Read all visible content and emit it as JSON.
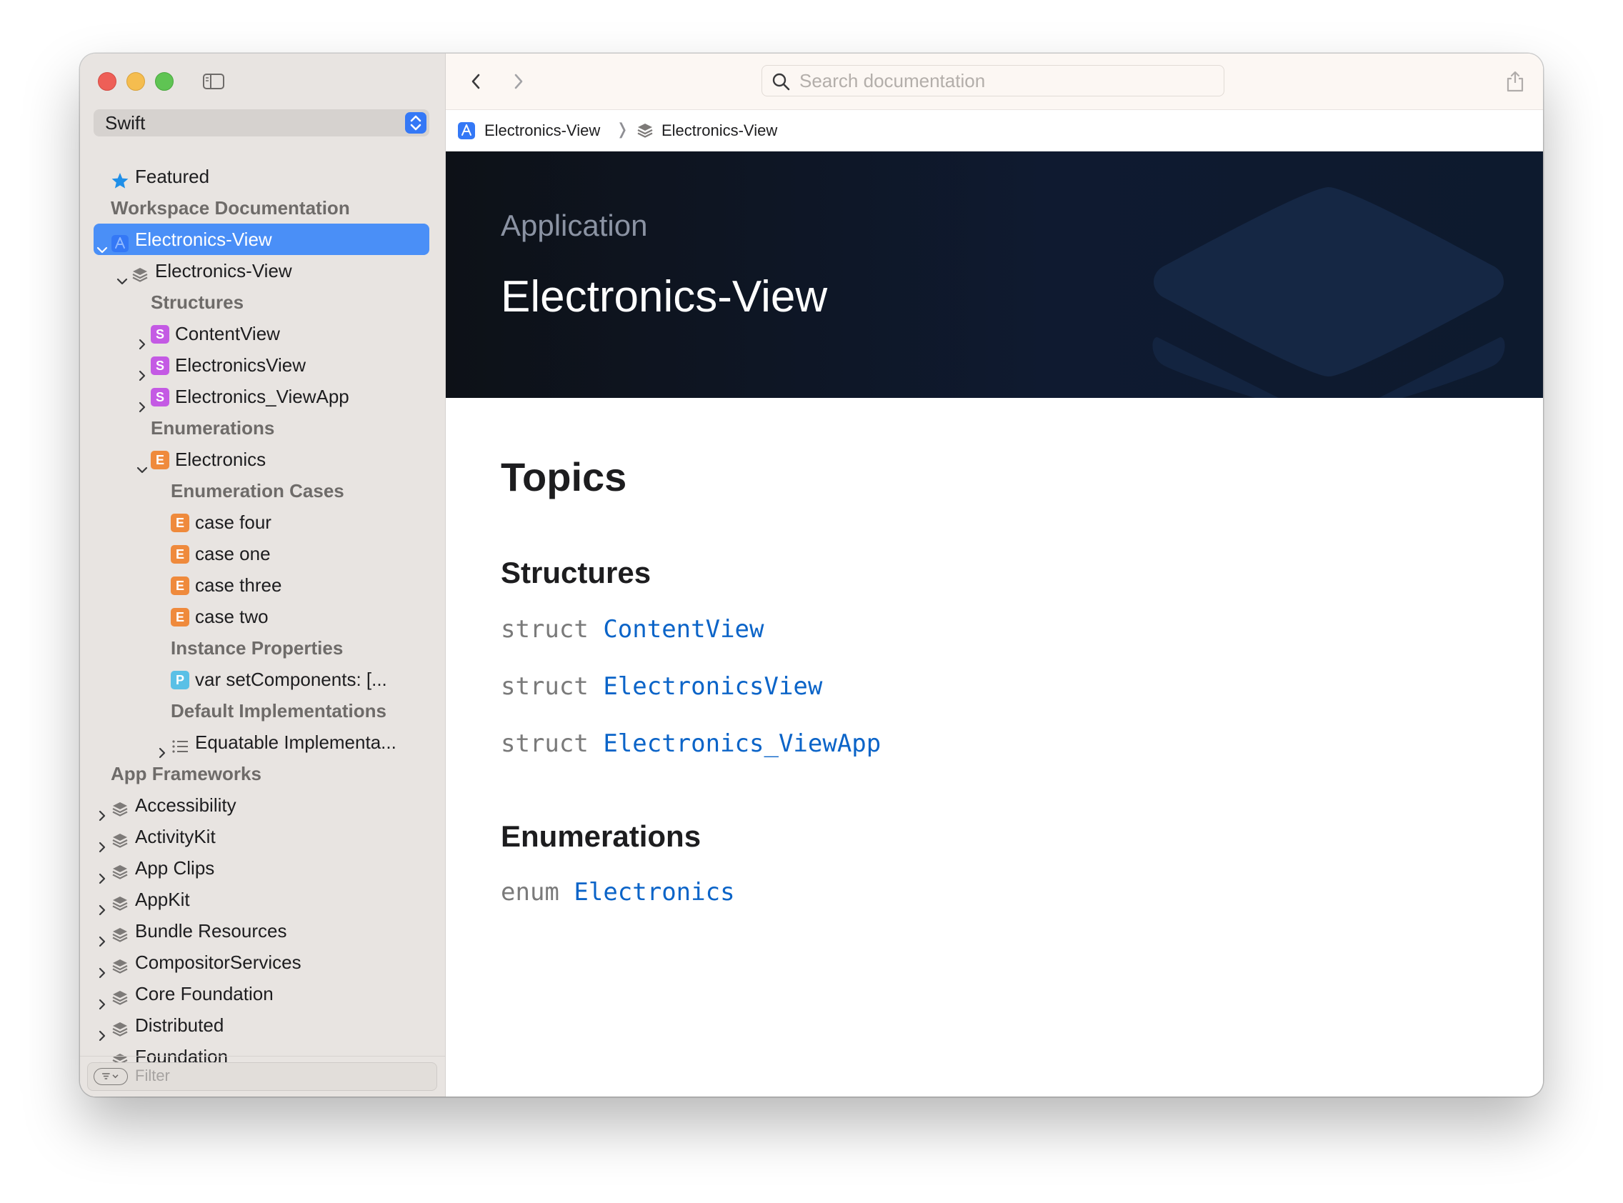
{
  "sidebar": {
    "language": "Swift",
    "filter_placeholder": "Filter",
    "tree": [
      {
        "label": "Featured",
        "level": 1,
        "kind": "featured",
        "expanded": null
      },
      {
        "label": "Workspace Documentation",
        "level": 1,
        "kind": "header"
      },
      {
        "label": "Electronics-View",
        "level": 1,
        "kind": "app",
        "expanded": true,
        "selected": true
      },
      {
        "label": "Electronics-View",
        "level": 2,
        "kind": "module",
        "expanded": true
      },
      {
        "label": "Structures",
        "level": 3,
        "kind": "header"
      },
      {
        "label": "ContentView",
        "level": 3,
        "kind": "struct",
        "expanded": false
      },
      {
        "label": "ElectronicsView",
        "level": 3,
        "kind": "struct",
        "expanded": false
      },
      {
        "label": "Electronics_ViewApp",
        "level": 3,
        "kind": "struct",
        "expanded": false
      },
      {
        "label": "Enumerations",
        "level": 3,
        "kind": "header"
      },
      {
        "label": "Electronics",
        "level": 3,
        "kind": "enum",
        "expanded": true
      },
      {
        "label": "Enumeration Cases",
        "level": 4,
        "kind": "header"
      },
      {
        "label": "case four",
        "level": 4,
        "kind": "enum"
      },
      {
        "label": "case one",
        "level": 4,
        "kind": "enum"
      },
      {
        "label": "case three",
        "level": 4,
        "kind": "enum"
      },
      {
        "label": "case two",
        "level": 4,
        "kind": "enum"
      },
      {
        "label": "Instance Properties",
        "level": 4,
        "kind": "header"
      },
      {
        "label": "var setComponents: [...",
        "level": 4,
        "kind": "property"
      },
      {
        "label": "Default Implementations",
        "level": 4,
        "kind": "header"
      },
      {
        "label": "Equatable Implementa...",
        "level": 4,
        "kind": "list",
        "expanded": false
      },
      {
        "label": "App Frameworks",
        "level": 1,
        "kind": "header"
      },
      {
        "label": "Accessibility",
        "level": 1,
        "kind": "module",
        "expanded": false
      },
      {
        "label": "ActivityKit",
        "level": 1,
        "kind": "module",
        "expanded": false
      },
      {
        "label": "App Clips",
        "level": 1,
        "kind": "module",
        "expanded": false
      },
      {
        "label": "AppKit",
        "level": 1,
        "kind": "module",
        "expanded": false
      },
      {
        "label": "Bundle Resources",
        "level": 1,
        "kind": "module",
        "expanded": false
      },
      {
        "label": "CompositorServices",
        "level": 1,
        "kind": "module",
        "expanded": false
      },
      {
        "label": "Core Foundation",
        "level": 1,
        "kind": "module",
        "expanded": false
      },
      {
        "label": "Distributed",
        "level": 1,
        "kind": "module",
        "expanded": false
      },
      {
        "label": "Foundation",
        "level": 1,
        "kind": "module",
        "expanded": false
      }
    ]
  },
  "toolbar": {
    "search_placeholder": "Search documentation"
  },
  "breadcrumb": {
    "items": [
      "Electronics-View",
      "Electronics-View"
    ],
    "separator": "❭"
  },
  "hero": {
    "eyebrow": "Application",
    "title": "Electronics-View"
  },
  "topics": {
    "title": "Topics",
    "sections": [
      {
        "title": "Structures",
        "items": [
          {
            "keyword": "struct",
            "name": "ContentView"
          },
          {
            "keyword": "struct",
            "name": "ElectronicsView"
          },
          {
            "keyword": "struct",
            "name": "Electronics_ViewApp"
          }
        ]
      },
      {
        "title": "Enumerations",
        "items": [
          {
            "keyword": "enum",
            "name": "Electronics"
          }
        ]
      }
    ]
  },
  "colors": {
    "accent": "#4a8ff7",
    "link": "#0b64c8",
    "struct_badge": "#c45ae4",
    "enum_badge": "#ef8a3c",
    "property_badge": "#5ac0e6"
  }
}
